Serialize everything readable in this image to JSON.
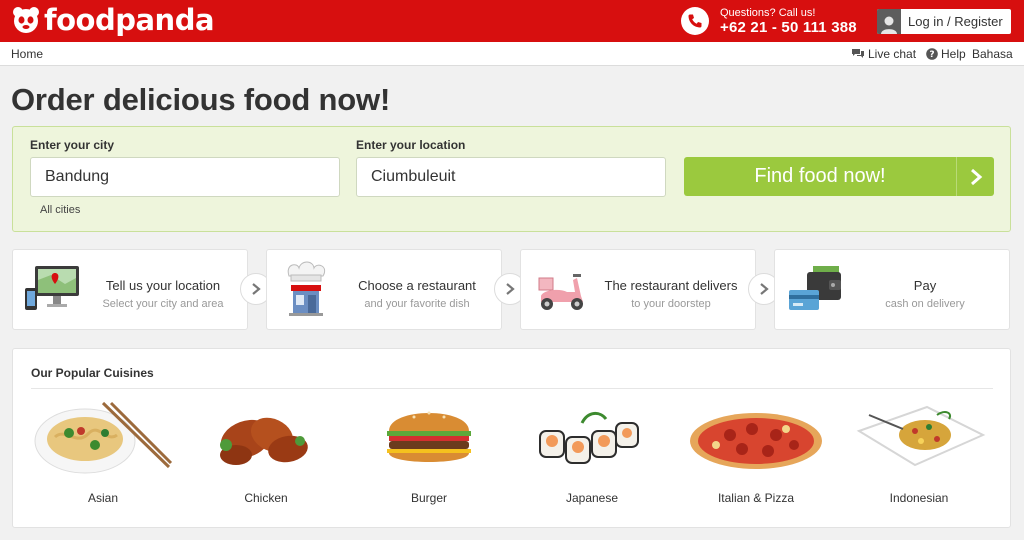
{
  "brand": {
    "name": "foodpanda",
    "accent": "#d70f0f",
    "green": "#9bc93e"
  },
  "header": {
    "phone_question": "Questions? Call us!",
    "phone_number": "+62 21 - 50 111 388",
    "login_label": "Log in / Register"
  },
  "subnav": {
    "home": "Home",
    "live_chat": "Live chat",
    "help": "Help",
    "language": "Bahasa"
  },
  "headline": "Order delicious food now!",
  "search": {
    "city_label": "Enter your city",
    "city_value": "Bandung",
    "location_label": "Enter your location",
    "location_value": "Ciumbuleuit",
    "all_cities": "All cities",
    "button": "Find food now!"
  },
  "steps": [
    {
      "title": "Tell us your location",
      "subtitle": "Select your city and area",
      "icon": "map-screen-icon"
    },
    {
      "title": "Choose a restaurant",
      "subtitle": "and your favorite dish",
      "icon": "chef-restaurant-icon"
    },
    {
      "title": "The restaurant delivers",
      "subtitle": "to your doorstep",
      "icon": "scooter-icon"
    },
    {
      "title": "Pay",
      "subtitle": "cash on delivery",
      "icon": "wallet-card-icon"
    }
  ],
  "cuisines": {
    "title": "Our Popular Cuisines",
    "items": [
      {
        "label": "Asian"
      },
      {
        "label": "Chicken"
      },
      {
        "label": "Burger"
      },
      {
        "label": "Japanese"
      },
      {
        "label": "Italian & Pizza"
      },
      {
        "label": "Indonesian"
      }
    ]
  }
}
